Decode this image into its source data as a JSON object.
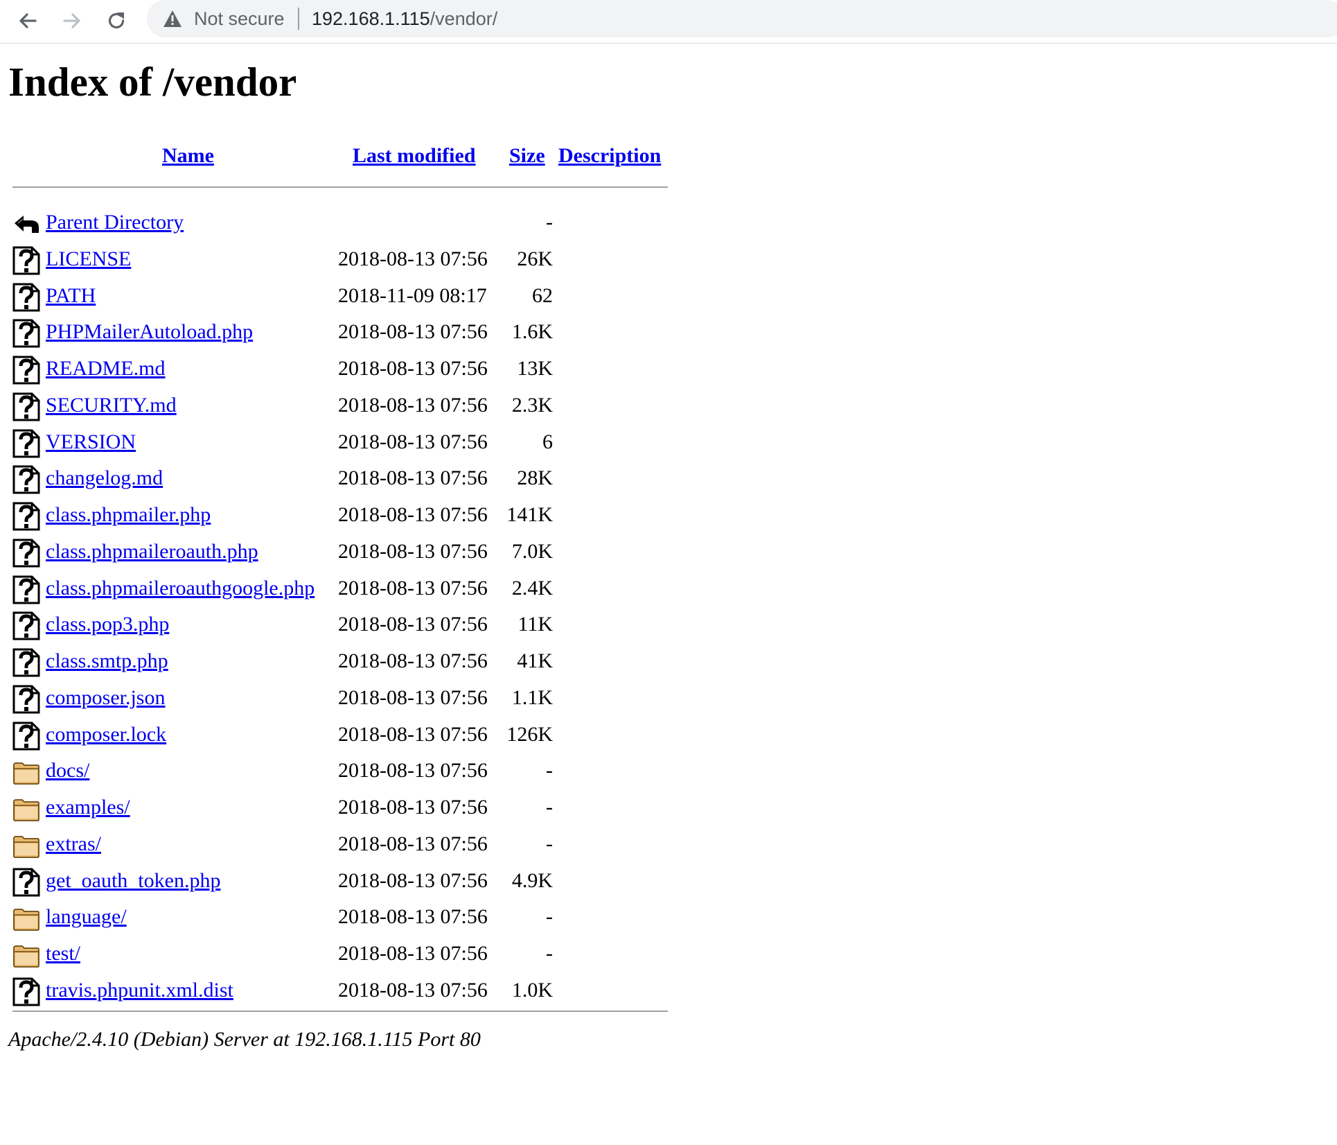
{
  "browser": {
    "security_label": "Not secure",
    "url_host": "192.168.1.115",
    "url_path": "/vendor/"
  },
  "page": {
    "title": "Index of /vendor"
  },
  "columns": {
    "name": "Name",
    "last_modified": "Last modified",
    "size": "Size",
    "description": "Description"
  },
  "rows": [
    {
      "type": "back",
      "name": "Parent Directory",
      "modified": "",
      "size": "-"
    },
    {
      "type": "file",
      "name": "LICENSE",
      "modified": "2018-08-13 07:56",
      "size": "26K"
    },
    {
      "type": "file",
      "name": "PATH",
      "modified": "2018-11-09 08:17",
      "size": "62"
    },
    {
      "type": "file",
      "name": "PHPMailerAutoload.php",
      "modified": "2018-08-13 07:56",
      "size": "1.6K"
    },
    {
      "type": "file",
      "name": "README.md",
      "modified": "2018-08-13 07:56",
      "size": "13K"
    },
    {
      "type": "file",
      "name": "SECURITY.md",
      "modified": "2018-08-13 07:56",
      "size": "2.3K"
    },
    {
      "type": "file",
      "name": "VERSION",
      "modified": "2018-08-13 07:56",
      "size": "6"
    },
    {
      "type": "file",
      "name": "changelog.md",
      "modified": "2018-08-13 07:56",
      "size": "28K"
    },
    {
      "type": "file",
      "name": "class.phpmailer.php",
      "modified": "2018-08-13 07:56",
      "size": "141K"
    },
    {
      "type": "file",
      "name": "class.phpmaileroauth.php",
      "modified": "2018-08-13 07:56",
      "size": "7.0K"
    },
    {
      "type": "file",
      "name": "class.phpmaileroauthgoogle.php",
      "modified": "2018-08-13 07:56",
      "size": "2.4K"
    },
    {
      "type": "file",
      "name": "class.pop3.php",
      "modified": "2018-08-13 07:56",
      "size": "11K"
    },
    {
      "type": "file",
      "name": "class.smtp.php",
      "modified": "2018-08-13 07:56",
      "size": "41K"
    },
    {
      "type": "file",
      "name": "composer.json",
      "modified": "2018-08-13 07:56",
      "size": "1.1K"
    },
    {
      "type": "file",
      "name": "composer.lock",
      "modified": "2018-08-13 07:56",
      "size": "126K"
    },
    {
      "type": "folder",
      "name": "docs/",
      "modified": "2018-08-13 07:56",
      "size": "-"
    },
    {
      "type": "folder",
      "name": "examples/",
      "modified": "2018-08-13 07:56",
      "size": "-"
    },
    {
      "type": "folder",
      "name": "extras/",
      "modified": "2018-08-13 07:56",
      "size": "-"
    },
    {
      "type": "file",
      "name": "get_oauth_token.php",
      "modified": "2018-08-13 07:56",
      "size": "4.9K"
    },
    {
      "type": "folder",
      "name": "language/",
      "modified": "2018-08-13 07:56",
      "size": "-"
    },
    {
      "type": "folder",
      "name": "test/",
      "modified": "2018-08-13 07:56",
      "size": "-"
    },
    {
      "type": "file",
      "name": "travis.phpunit.xml.dist",
      "modified": "2018-08-13 07:56",
      "size": "1.0K"
    }
  ],
  "footer": {
    "address": "Apache/2.4.10 (Debian) Server at 192.168.1.115 Port 80"
  }
}
